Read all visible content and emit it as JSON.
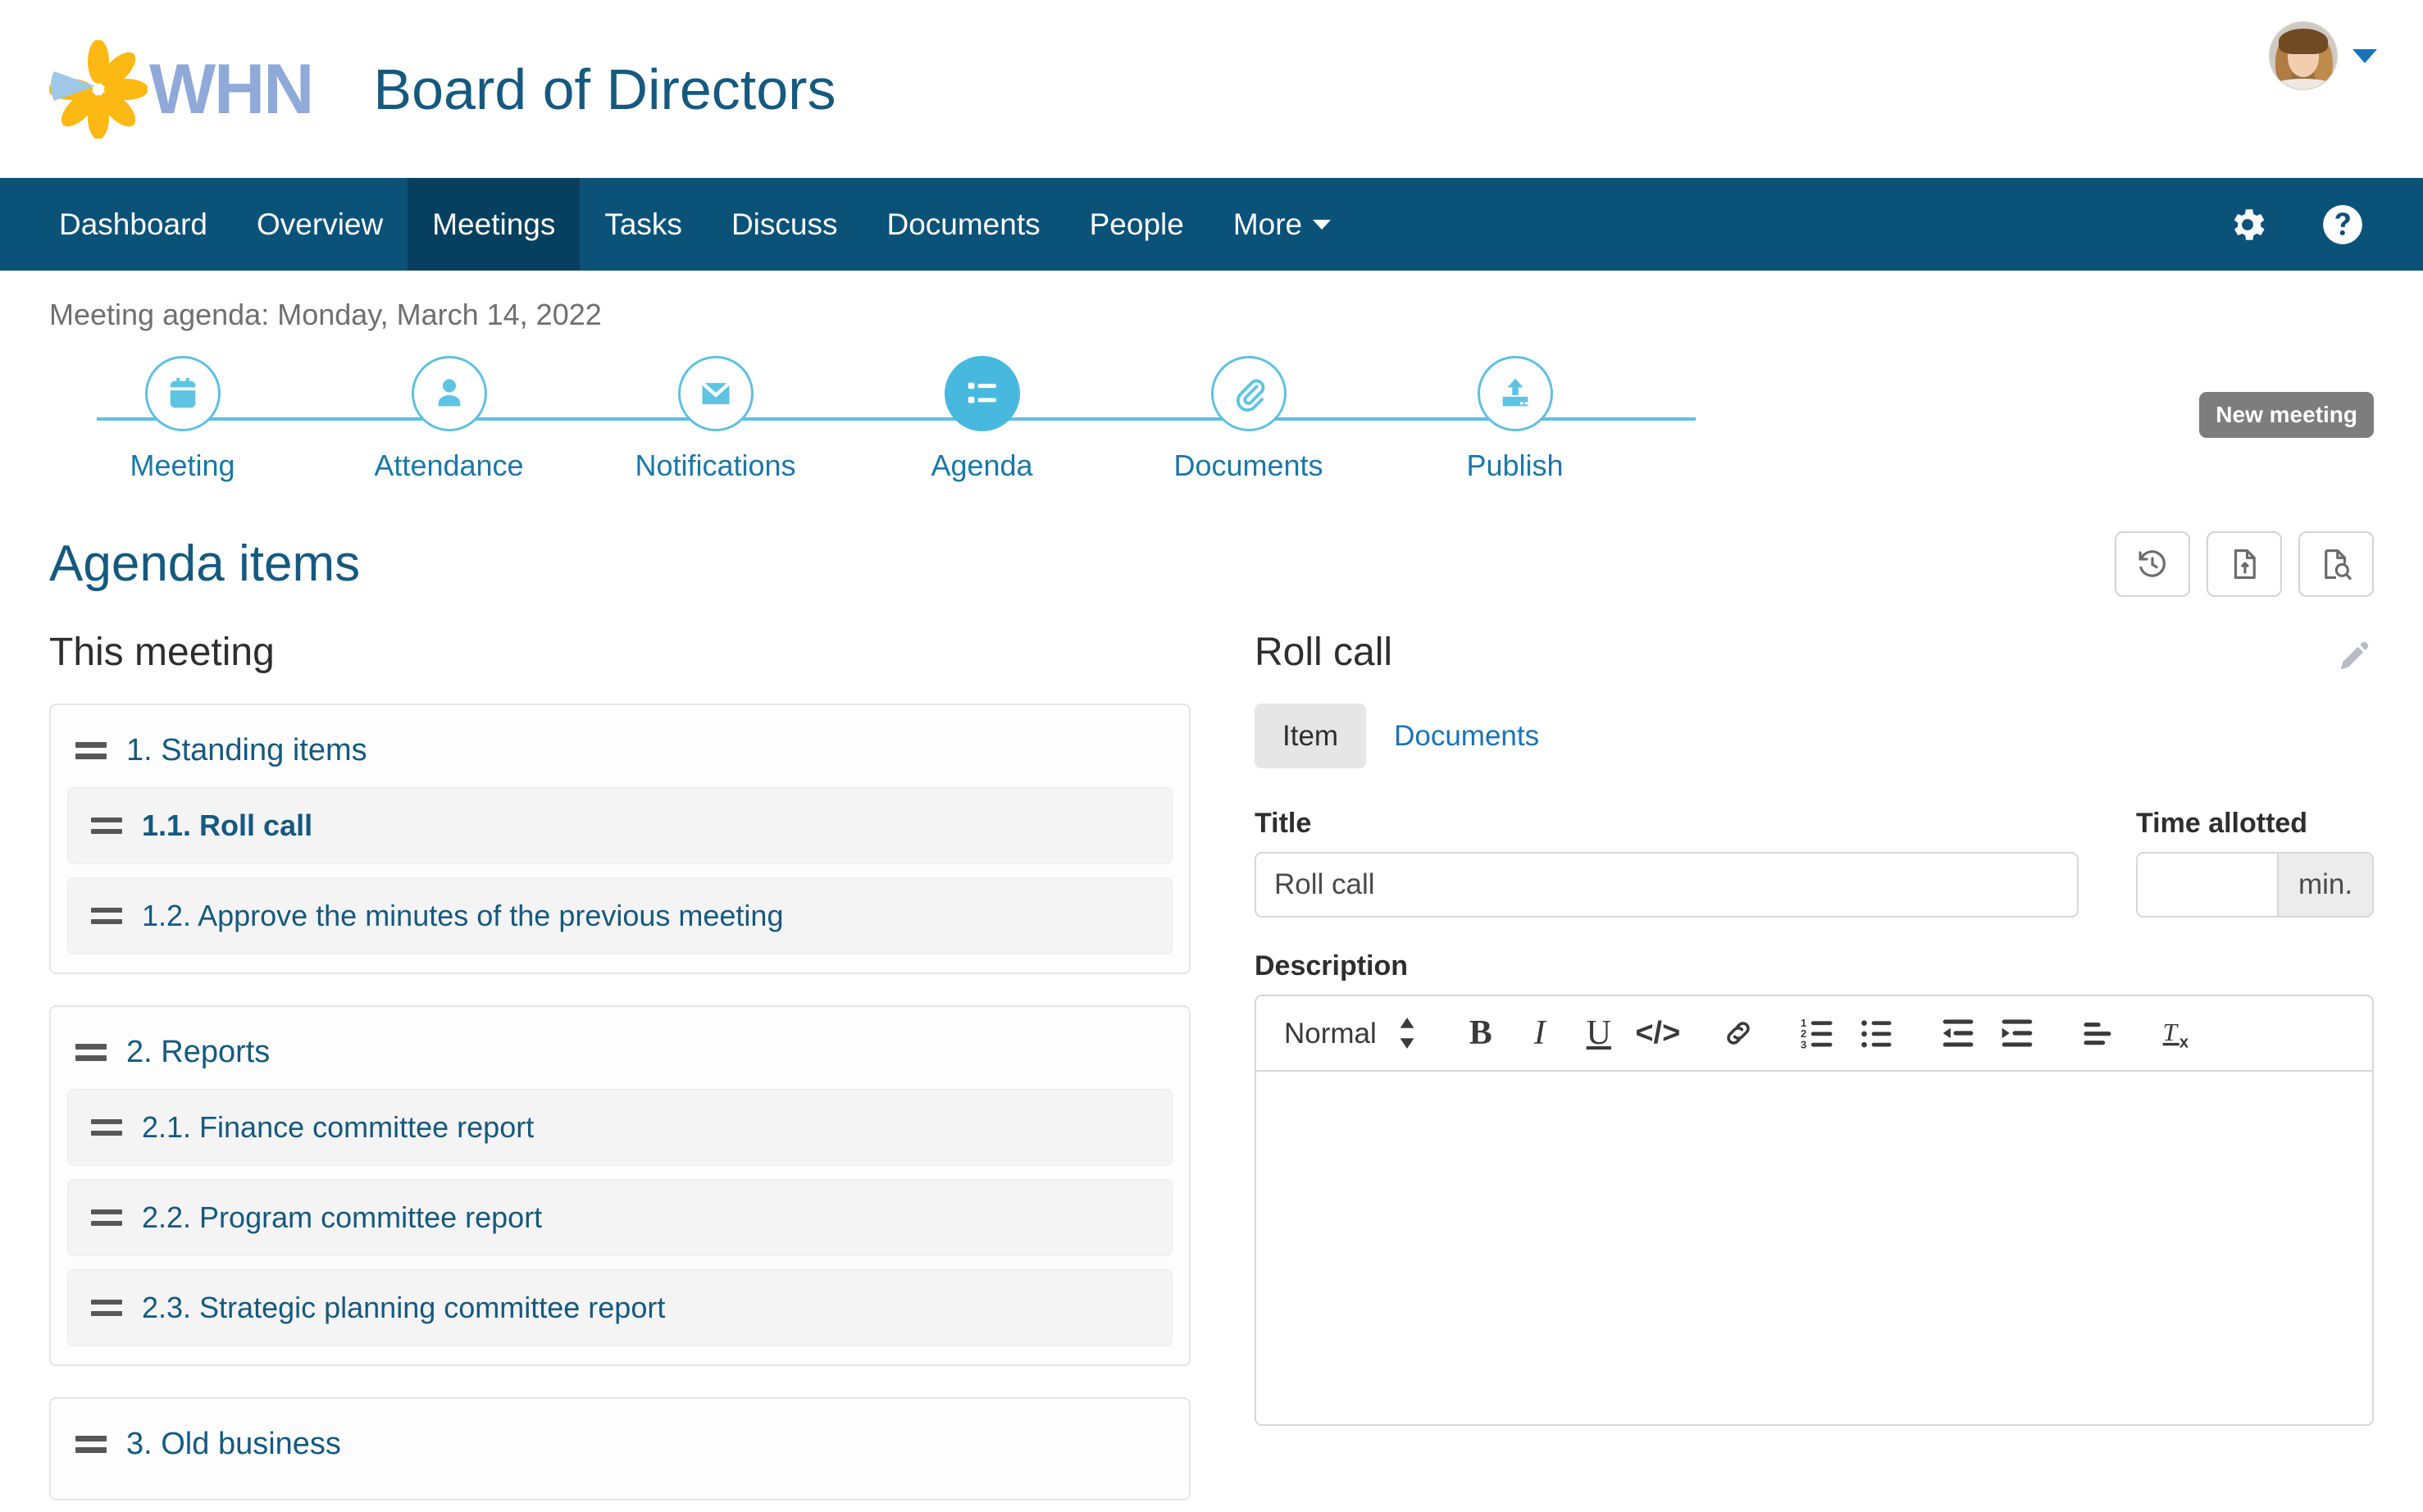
{
  "header": {
    "logo_text": "WHN",
    "app_title": "Board of Directors",
    "avatar_name": "avatar",
    "caret": "chevron-down"
  },
  "nav": {
    "items": [
      {
        "label": "Dashboard",
        "active": false,
        "caret": false
      },
      {
        "label": "Overview",
        "active": false,
        "caret": false
      },
      {
        "label": "Meetings",
        "active": true,
        "caret": false
      },
      {
        "label": "Tasks",
        "active": false,
        "caret": false
      },
      {
        "label": "Discuss",
        "active": false,
        "caret": false
      },
      {
        "label": "Documents",
        "active": false,
        "caret": false
      },
      {
        "label": "People",
        "active": false,
        "caret": false
      },
      {
        "label": "More",
        "active": false,
        "caret": true
      }
    ],
    "right_icons": [
      "gear-icon",
      "help-icon"
    ]
  },
  "subheader": {
    "meeting_date": "Meeting agenda: Monday, March 14, 2022",
    "new_meeting_badge": "New meeting"
  },
  "stepper": {
    "steps": [
      {
        "label": "Meeting",
        "icon": "calendar-icon",
        "active": false
      },
      {
        "label": "Attendance",
        "icon": "person-icon",
        "active": false
      },
      {
        "label": "Notifications",
        "icon": "envelope-icon",
        "active": false
      },
      {
        "label": "Agenda",
        "icon": "list-icon",
        "active": true
      },
      {
        "label": "Documents",
        "icon": "paperclip-icon",
        "active": false
      },
      {
        "label": "Publish",
        "icon": "upload-icon",
        "active": false
      }
    ]
  },
  "agenda": {
    "title": "Agenda items",
    "tool_buttons": [
      {
        "name": "history-icon",
        "label": "History"
      },
      {
        "name": "file-upload-icon",
        "label": "Upload document"
      },
      {
        "name": "file-preview-icon",
        "label": "Preview"
      }
    ],
    "section_heading": "This meeting",
    "groups": [
      {
        "title": "1. Standing items",
        "items": [
          {
            "title": "1.1. Roll call",
            "selected": true
          },
          {
            "title": "1.2. Approve the minutes of the previous meeting",
            "selected": false
          }
        ]
      },
      {
        "title": "2. Reports",
        "items": [
          {
            "title": "2.1. Finance committee report",
            "selected": false
          },
          {
            "title": "2.2. Program committee report",
            "selected": false
          },
          {
            "title": "2.3. Strategic planning committee report",
            "selected": false
          }
        ]
      },
      {
        "title": "3. Old business",
        "items": []
      }
    ]
  },
  "detail": {
    "title": "Roll call",
    "edit_icon": "pencil-icon",
    "tabs": [
      {
        "label": "Item",
        "active": true
      },
      {
        "label": "Documents",
        "active": false
      }
    ],
    "title_label": "Title",
    "title_value": "Roll call",
    "time_label": "Time allotted",
    "time_value": "",
    "time_placeholder": "",
    "time_unit": "min.",
    "description_label": "Description",
    "editor": {
      "format_label": "Normal",
      "buttons": [
        {
          "name": "bold-icon",
          "glyph": "B"
        },
        {
          "name": "italic-icon",
          "glyph": "I"
        },
        {
          "name": "underline-icon",
          "glyph": "U"
        },
        {
          "name": "code-icon",
          "glyph": "</>"
        },
        {
          "name": "link-icon",
          "glyph": ""
        },
        {
          "name": "ordered-list-icon",
          "glyph": ""
        },
        {
          "name": "bullet-list-icon",
          "glyph": ""
        },
        {
          "name": "outdent-icon",
          "glyph": ""
        },
        {
          "name": "indent-icon",
          "glyph": ""
        },
        {
          "name": "align-icon",
          "glyph": ""
        },
        {
          "name": "clear-format-icon",
          "glyph": ""
        }
      ],
      "content": ""
    }
  },
  "colors": {
    "nav_bg": "#0b5279",
    "nav_active_bg": "#07405f",
    "brand_blue": "#15597f",
    "accent_cyan": "#47b9de",
    "link_blue": "#1a73b8",
    "logo_yellow": "#fdb913",
    "logo_lightblue": "#9ec7e8",
    "logo_word": "#8fa9d8"
  }
}
